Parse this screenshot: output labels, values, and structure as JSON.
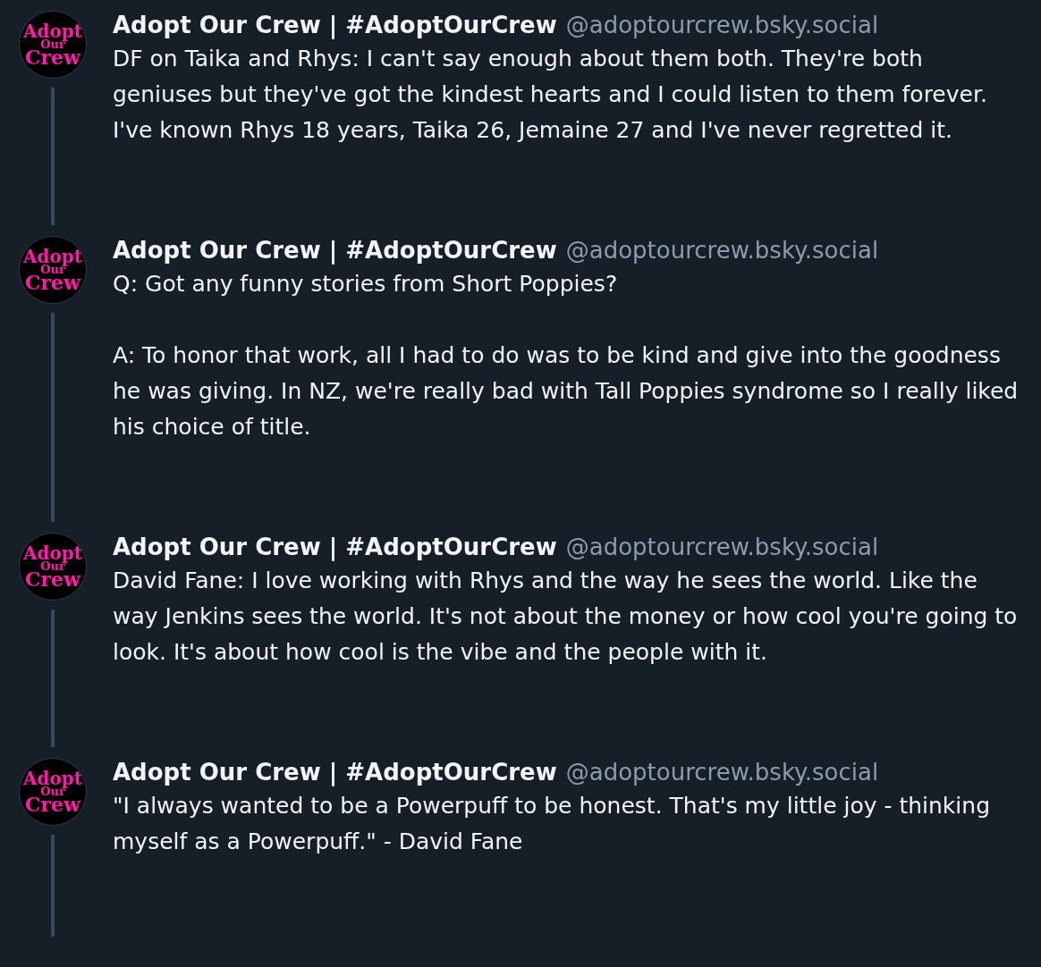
{
  "posts": [
    {
      "avatar_lines": [
        "Adopt",
        "Our",
        "Crew"
      ],
      "display_name": "Adopt Our Crew | #AdoptOurCrew",
      "handle": "@adoptourcrew.bsky.social",
      "paragraphs": [
        "DF on Taika and Rhys: I can't say enough about them both. They're both geniuses but they've got the kindest hearts and I could listen to them forever. I've known Rhys 18 years, Taika 26, Jemaine 27 and I've never regretted it."
      ]
    },
    {
      "avatar_lines": [
        "Adopt",
        "Our",
        "Crew"
      ],
      "display_name": "Adopt Our Crew | #AdoptOurCrew",
      "handle": "@adoptourcrew.bsky.social",
      "paragraphs": [
        "Q: Got any funny stories from Short Poppies?",
        "A: To honor that work, all I had to do was to be kind and give into the goodness he was giving. In NZ, we're really bad with Tall Poppies syndrome so I really liked his choice of title."
      ]
    },
    {
      "avatar_lines": [
        "Adopt",
        "Our",
        "Crew"
      ],
      "display_name": "Adopt Our Crew | #AdoptOurCrew",
      "handle": "@adoptourcrew.bsky.social",
      "paragraphs": [
        "David Fane: I love working with Rhys and the way he sees the world. Like the way Jenkins sees the world. It's not about the money or how cool you're going to look. It's about how cool is the vibe and the people with it."
      ]
    },
    {
      "avatar_lines": [
        "Adopt",
        "Our",
        "Crew"
      ],
      "display_name": "Adopt Our Crew | #AdoptOurCrew",
      "handle": "@adoptourcrew.bsky.social",
      "paragraphs": [
        "\"I always wanted to be a Powerpuff to be honest. That's my little joy - thinking myself as a Powerpuff.\" - David Fane"
      ]
    }
  ]
}
